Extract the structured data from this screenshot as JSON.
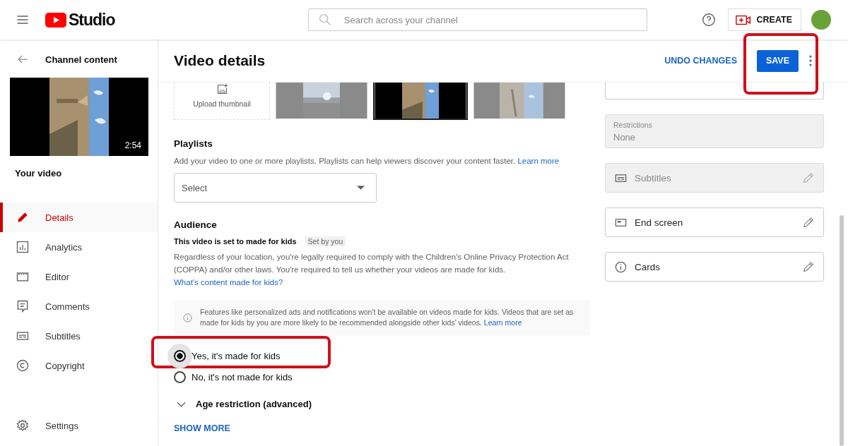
{
  "header": {
    "logo_text": "Studio",
    "search": {
      "placeholder": "Search across your channel"
    },
    "create_button": "CREATE"
  },
  "sidebar": {
    "back_label": "Channel content",
    "video": {
      "kind": "picture",
      "duration": "2:54"
    },
    "your_video": "Your video",
    "items": [
      {
        "label": "Details",
        "kind": "pencil",
        "selected": true
      },
      {
        "label": "Analytics",
        "kind": "chart",
        "selected": false
      },
      {
        "label": "Editor",
        "kind": "clapper",
        "selected": false
      },
      {
        "label": "Comments",
        "kind": "comment",
        "selected": false
      },
      {
        "label": "Subtitles",
        "kind": "subtitles",
        "selected": false
      },
      {
        "label": "Copyright",
        "kind": "copyright",
        "selected": false
      }
    ],
    "settings": "Settings"
  },
  "page": {
    "title": "Video details",
    "undo_button": "UNDO CHANGES",
    "save_button": "SAVE"
  },
  "thumbnails": {
    "upload_label": "Upload thumbnail",
    "options": [
      {
        "kind": "picture",
        "selected": false
      },
      {
        "kind": "picture",
        "selected": true
      },
      {
        "kind": "picture",
        "selected": false
      }
    ]
  },
  "playlists": {
    "heading": "Playlists",
    "description": "Add your video to one or more playlists. Playlists can help viewers discover your content faster.",
    "link": "Learn more",
    "select": "Select"
  },
  "audience": {
    "heading": "Audience",
    "status": "This video is set to made for kids",
    "chip": "Set by you",
    "description": "Regardless of your location, you're legally required to comply with the Children's Online Privacy Protection Act (COPPA) and/or other laws. You're required to tell us whether your videos are made for kids.",
    "description_link": "What's content made for kids?",
    "notice": "Features like personalized ads and notifications won't be available on videos made for kids. Videos that are set as made for kids by you are more likely to be recommended alongside other kids' videos.",
    "notice_link": "Learn more",
    "options": [
      {
        "label": "Yes, it's made for kids",
        "selected": true
      },
      {
        "label": "No, it's not made for kids",
        "selected": false
      }
    ],
    "age_restriction": {
      "label": "Age restriction (advanced)",
      "expanded": false
    },
    "show_more": "SHOW MORE"
  },
  "side_panel": {
    "restrictions": {
      "label": "Restrictions",
      "value": "None"
    },
    "cards": [
      {
        "label": "Subtitles",
        "kind": "subtitles",
        "disabled": true
      },
      {
        "label": "End screen",
        "kind": "endscreen",
        "disabled": false
      },
      {
        "label": "Cards",
        "kind": "info",
        "disabled": false
      }
    ]
  },
  "highlights": [
    {
      "kind": "rectangle"
    },
    {
      "kind": "rectangle"
    }
  ]
}
